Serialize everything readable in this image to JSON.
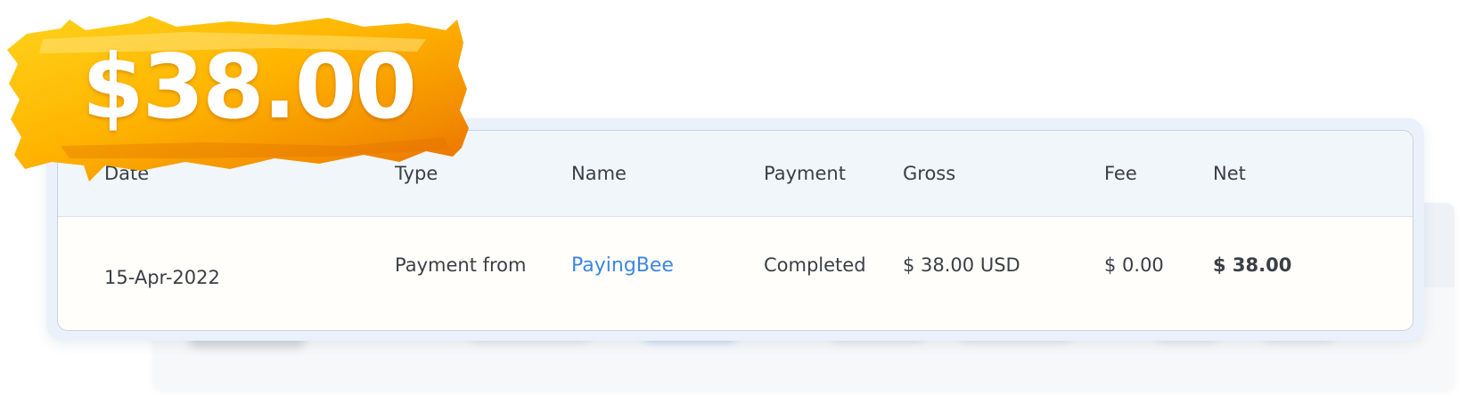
{
  "badge": {
    "amount": "$38.00"
  },
  "table": {
    "headers": {
      "date": "Date",
      "type": "Type",
      "name": "Name",
      "payment": "Payment",
      "gross": "Gross",
      "fee": "Fee",
      "net": "Net"
    },
    "row": {
      "date": "15-Apr-2022",
      "type": "Payment from",
      "name": "PayingBee",
      "payment": "Completed",
      "gross": "$ 38.00 USD",
      "fee": "$ 0.00",
      "net": "$ 38.00"
    }
  },
  "colors": {
    "link": "#3d86e0",
    "header_bg": "#f1f6fb",
    "badge_orange": "#f5a300"
  }
}
